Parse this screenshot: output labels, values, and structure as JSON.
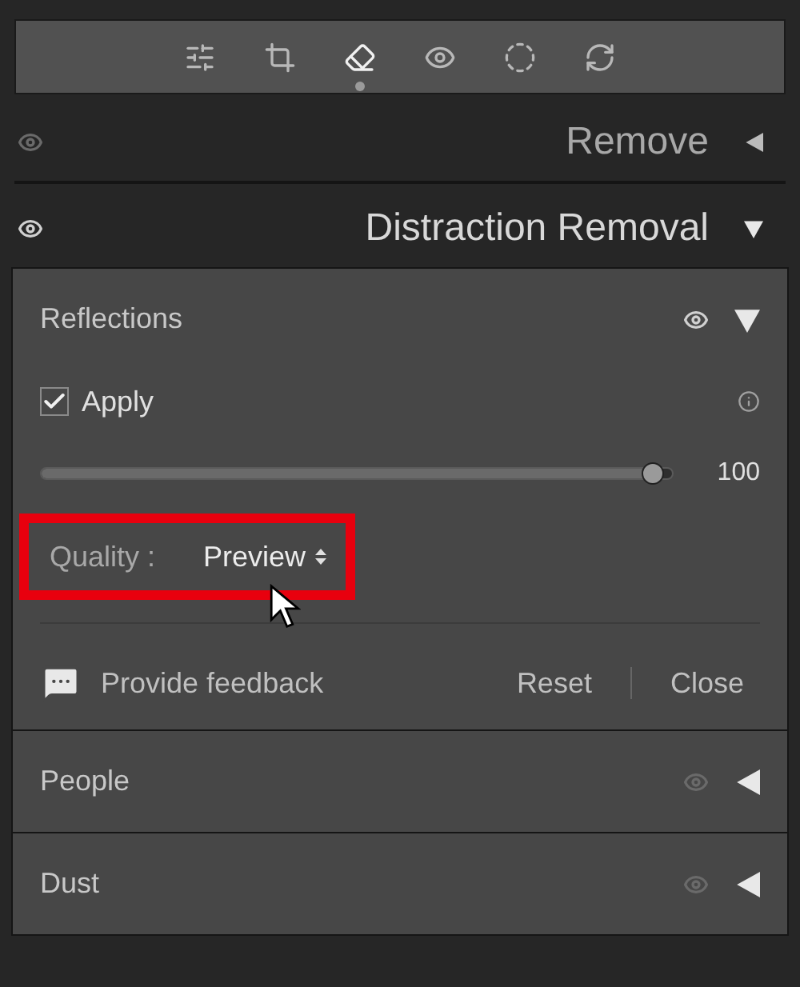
{
  "tools": [
    {
      "selected": false
    },
    {
      "selected": false
    },
    {
      "selected": true
    },
    {
      "selected": false
    },
    {
      "selected": false
    },
    {
      "selected": false
    }
  ],
  "sections": [
    {
      "title": "Remove",
      "expanded": false,
      "visible": false
    },
    {
      "title": "Distraction Removal",
      "expanded": true,
      "visible": true
    }
  ],
  "subsections": [
    {
      "title": "Reflections",
      "expanded": true,
      "visible": true
    },
    {
      "title": "People",
      "expanded": false,
      "visible": false
    },
    {
      "title": "Dust",
      "expanded": false,
      "visible": false
    }
  ],
  "apply": {
    "label": "Apply",
    "checked": true
  },
  "amount": {
    "level": 0.97,
    "reading": "100"
  },
  "quality": {
    "label": "Quality :",
    "value": "Preview"
  },
  "footer": {
    "feedback": "Provide feedback",
    "reset": "Reset",
    "close": "Close"
  }
}
